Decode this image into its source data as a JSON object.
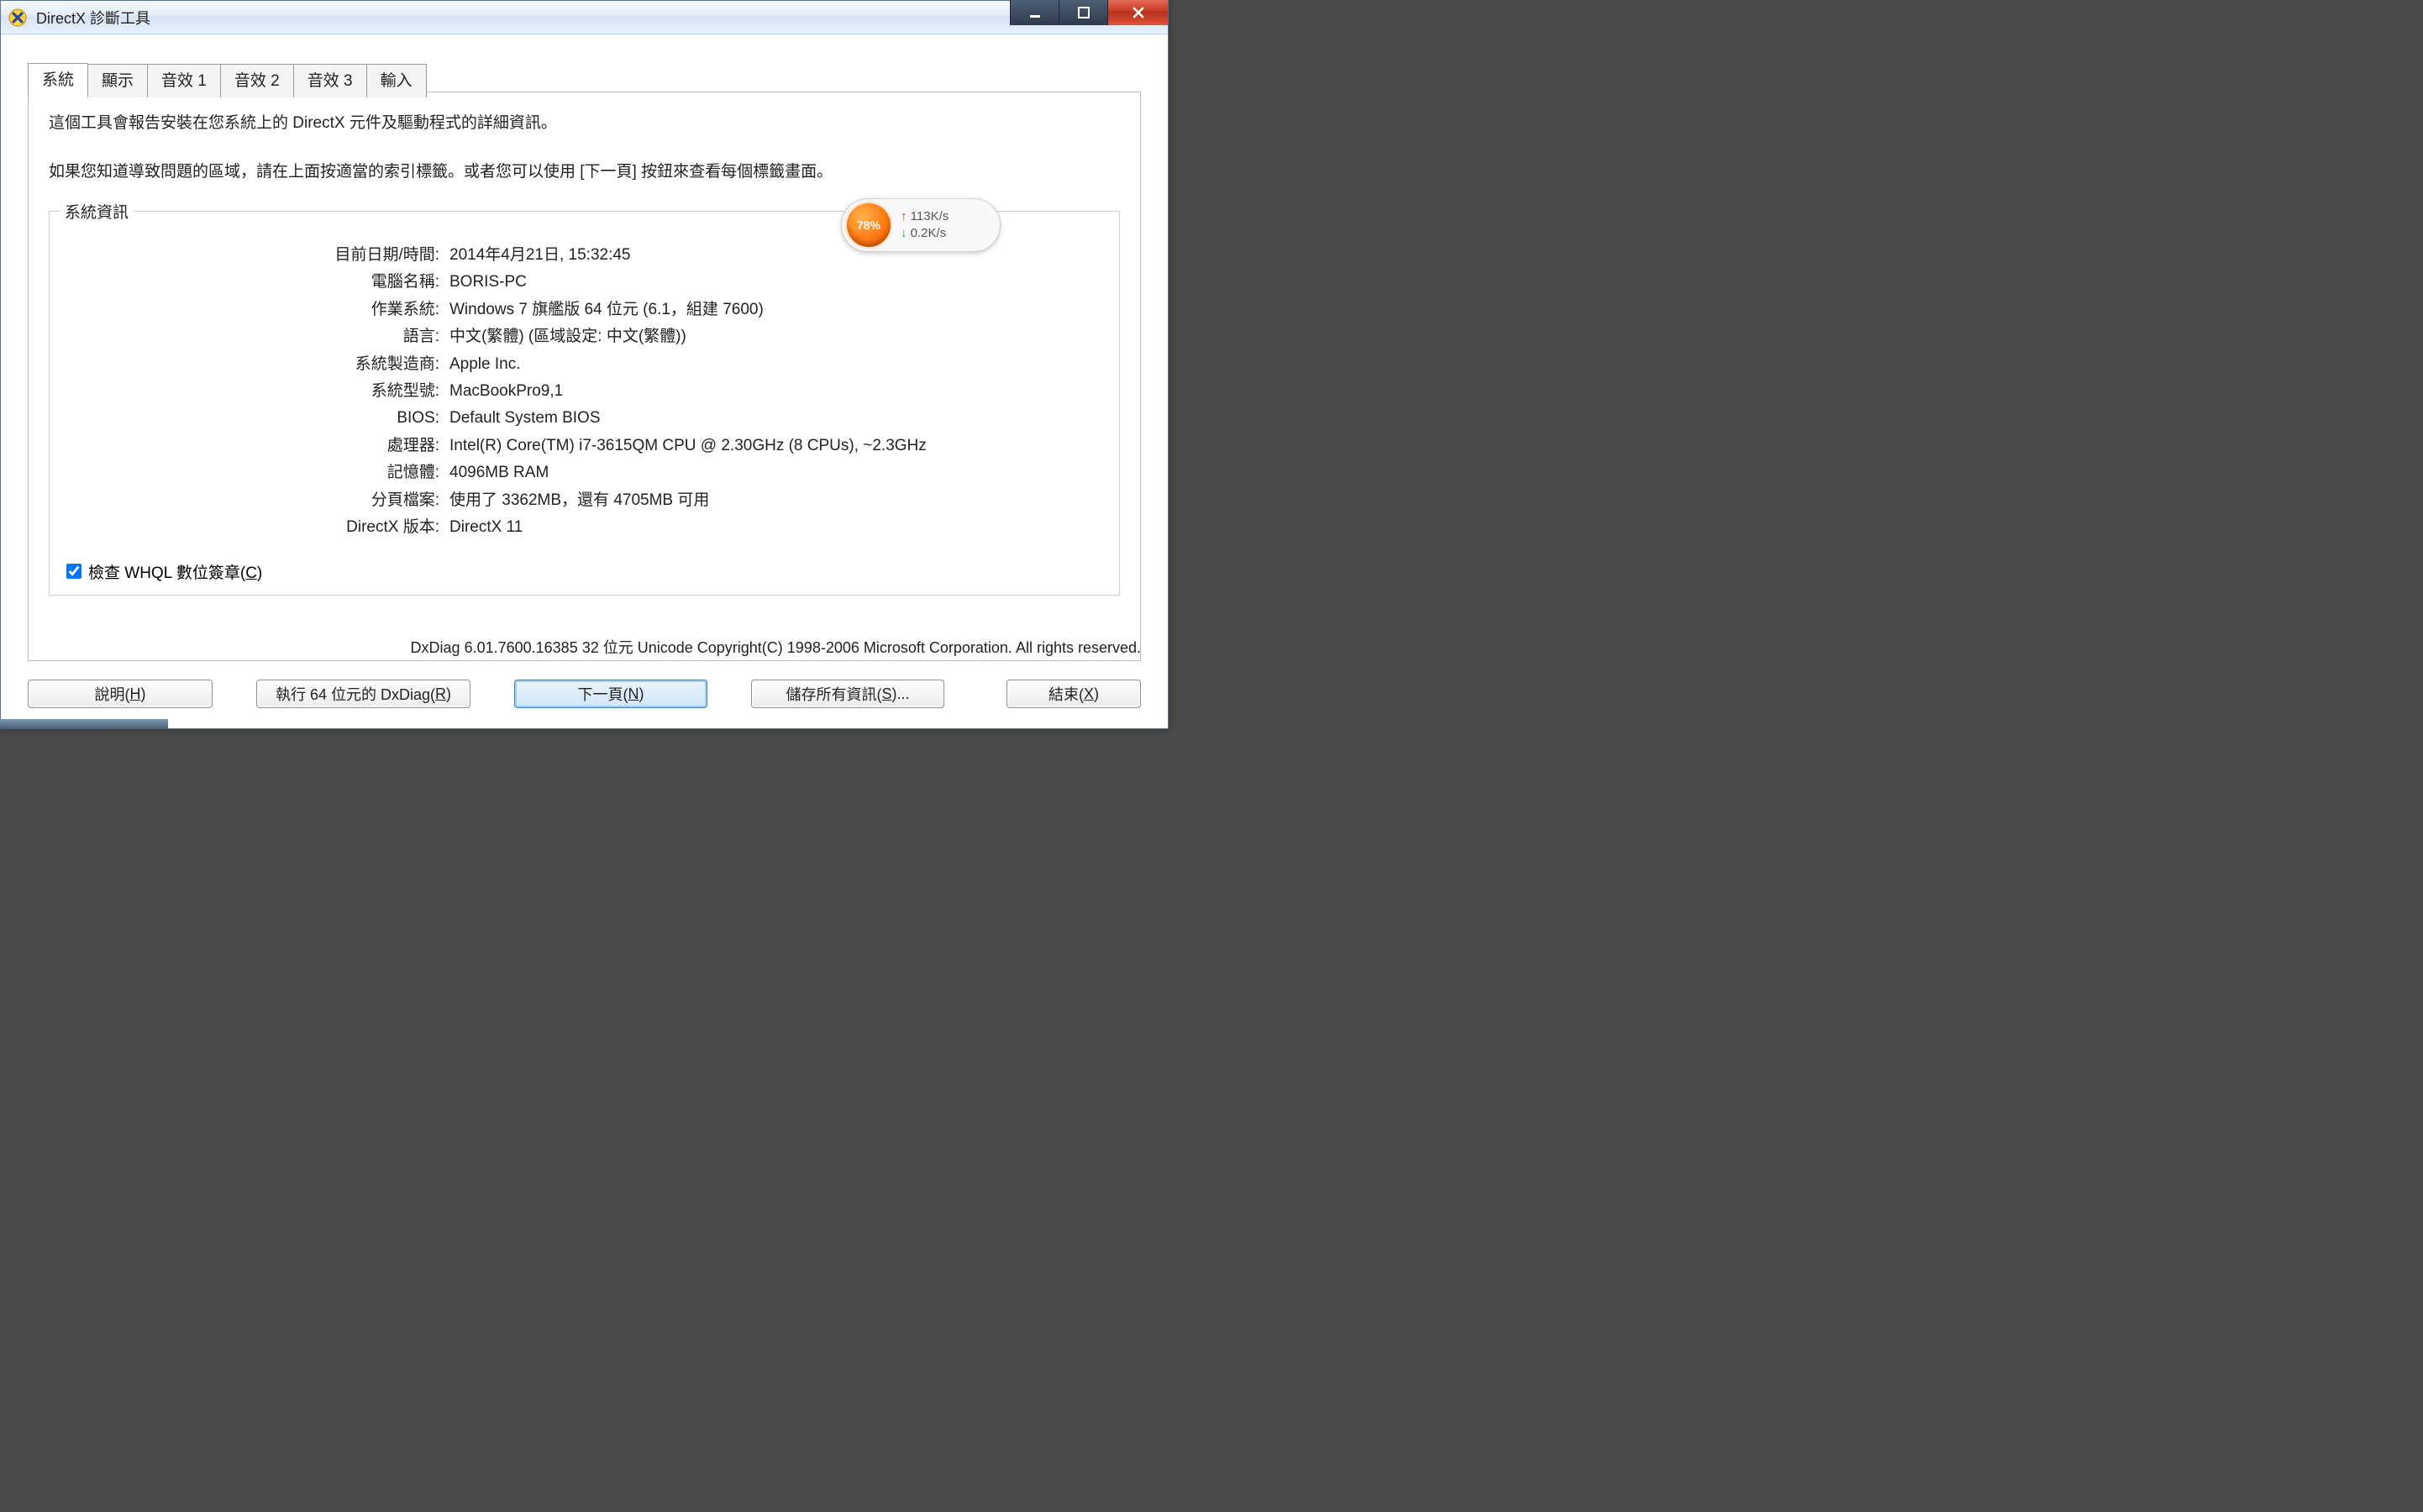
{
  "window": {
    "title": "DirectX 診斷工具"
  },
  "tabs": [
    {
      "label": "系統"
    },
    {
      "label": "顯示"
    },
    {
      "label": "音效 1"
    },
    {
      "label": "音效 2"
    },
    {
      "label": "音效 3"
    },
    {
      "label": "輸入"
    }
  ],
  "intro": {
    "line1": "這個工具會報告安裝在您系統上的 DirectX 元件及驅動程式的詳細資訊。",
    "line2": "如果您知道導致問題的區域，請在上面按適當的索引標籤。或者您可以使用 [下一頁] 按鈕來查看每個標籤畫面。"
  },
  "system_info": {
    "legend": "系統資訊",
    "rows": [
      {
        "label": "目前日期/時間:",
        "value": "2014年4月21日, 15:32:45"
      },
      {
        "label": "電腦名稱:",
        "value": "BORIS-PC"
      },
      {
        "label": "作業系統:",
        "value": "Windows 7 旗艦版 64 位元 (6.1，組建 7600)"
      },
      {
        "label": "語言:",
        "value": "中文(繁體) (區域設定: 中文(繁體))"
      },
      {
        "label": "系統製造商:",
        "value": "Apple Inc."
      },
      {
        "label": "系統型號:",
        "value": "MacBookPro9,1"
      },
      {
        "label": "BIOS:",
        "value": "Default System BIOS"
      },
      {
        "label": "處理器:",
        "value": "Intel(R) Core(TM) i7-3615QM CPU @ 2.30GHz (8 CPUs), ~2.3GHz"
      },
      {
        "label": "記憶體:",
        "value": "4096MB RAM"
      },
      {
        "label": "分頁檔案:",
        "value": "使用了 3362MB，還有 4705MB 可用"
      },
      {
        "label": "DirectX 版本:",
        "value": "DirectX 11"
      }
    ],
    "whql_prefix": "檢查 WHQL 數位簽章(",
    "whql_key": "C",
    "whql_suffix": ")",
    "whql_checked": true
  },
  "copyright": "DxDiag 6.01.7600.16385 32 位元 Unicode  Copyright(C) 1998-2006 Microsoft Corporation.  All rights reserved.",
  "buttons": {
    "help": {
      "pre": "說明(",
      "key": "H",
      "post": ")"
    },
    "run64": {
      "pre": "執行 64 位元的 DxDiag(",
      "key": "R",
      "post": ")"
    },
    "next": {
      "pre": "下一頁(",
      "key": "N",
      "post": ")"
    },
    "save": {
      "pre": "儲存所有資訊(",
      "key": "S",
      "post": ")..."
    },
    "exit": {
      "pre": "結束(",
      "key": "X",
      "post": ")"
    }
  },
  "net_widget": {
    "percent": "78%",
    "up": "113K/s",
    "down": "0.2K/s"
  }
}
